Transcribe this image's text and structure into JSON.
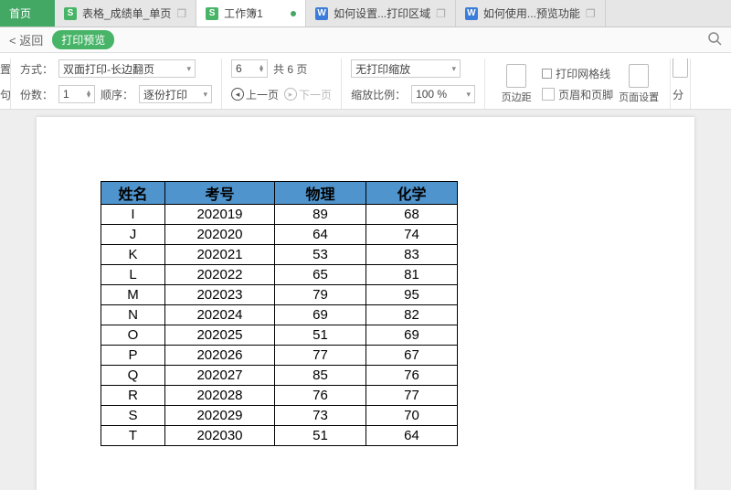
{
  "tabs": {
    "home": "首页",
    "t1": {
      "label": "表格_成绩单_单页",
      "icon": "S"
    },
    "t2": {
      "label": "工作簿1",
      "icon": "S"
    },
    "t3": {
      "label": "如何设置...打印区域",
      "icon": "W"
    },
    "t4": {
      "label": "如何使用...预览功能",
      "icon": "W"
    }
  },
  "subbar": {
    "back": "返回",
    "title": "打印预览"
  },
  "ribbon": {
    "cutleft1": "置",
    "cutleft2": "句",
    "mode_lbl": "方式：",
    "mode_val": "双面打印-长边翻页",
    "copies_lbl": "份数：",
    "copies_val": "1",
    "order_lbl": "顺序：",
    "order_val": "逐份打印",
    "page_val": "6",
    "total_pages": "共 6 页",
    "prev": "上一页",
    "next": "下一页",
    "scale_mode": "无打印缩放",
    "scale_ratio_lbl": "缩放比例：",
    "scale_ratio_val": "100 %",
    "margins": "页边距",
    "gridlines": "打印网格线",
    "headerfooter": "页眉和页脚",
    "pagesetup": "页面设置",
    "cutright": "分"
  },
  "chart_data": {
    "type": "table",
    "headers": [
      "姓名",
      "考号",
      "物理",
      "化学"
    ],
    "rows": [
      [
        "I",
        "202019",
        "89",
        "68"
      ],
      [
        "J",
        "202020",
        "64",
        "74"
      ],
      [
        "K",
        "202021",
        "53",
        "83"
      ],
      [
        "L",
        "202022",
        "65",
        "81"
      ],
      [
        "M",
        "202023",
        "79",
        "95"
      ],
      [
        "N",
        "202024",
        "69",
        "82"
      ],
      [
        "O",
        "202025",
        "51",
        "69"
      ],
      [
        "P",
        "202026",
        "77",
        "67"
      ],
      [
        "Q",
        "202027",
        "85",
        "76"
      ],
      [
        "R",
        "202028",
        "76",
        "77"
      ],
      [
        "S",
        "202029",
        "73",
        "70"
      ],
      [
        "T",
        "202030",
        "51",
        "64"
      ]
    ]
  }
}
